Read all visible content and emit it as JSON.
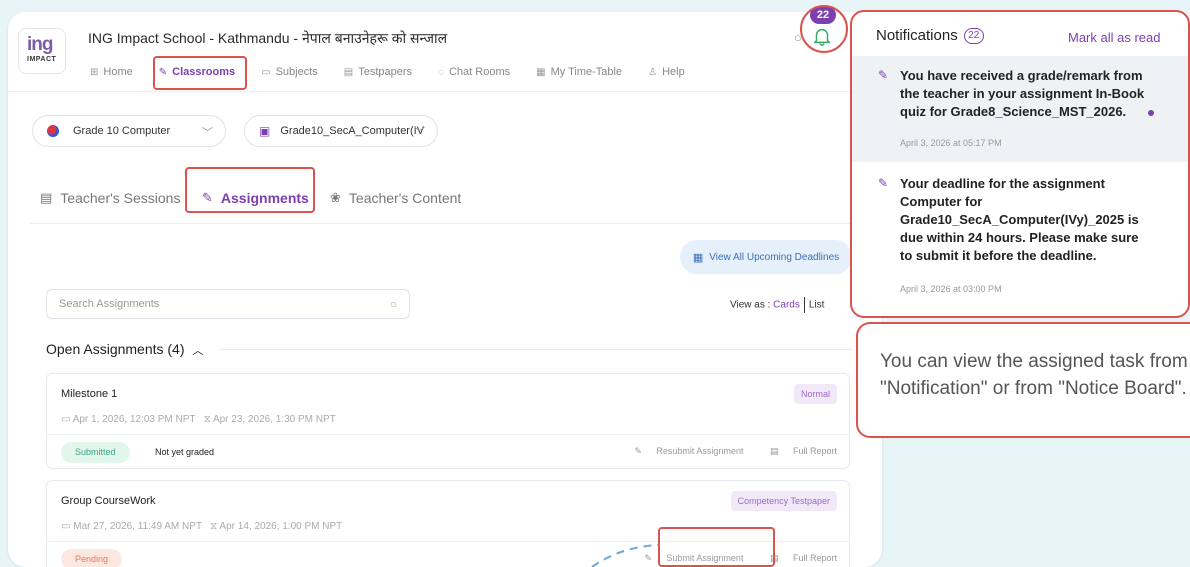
{
  "header": {
    "logo": {
      "word": "ing",
      "sub": "IMPACT"
    },
    "school_title": "ING Impact School - Kathmandu - नेपाल बनाउनेहरू को सन्जाल",
    "nav": [
      {
        "label": "Home",
        "icon": "grid-icon",
        "active": false
      },
      {
        "label": "Classrooms",
        "icon": "pen-icon",
        "active": true
      },
      {
        "label": "Subjects",
        "icon": "book-icon",
        "active": false
      },
      {
        "label": "Testpapers",
        "icon": "document-icon",
        "active": false
      },
      {
        "label": "Chat Rooms",
        "icon": "chat-icon",
        "active": false
      },
      {
        "label": "My Time-Table",
        "icon": "calendar-icon",
        "active": false
      },
      {
        "label": "Help",
        "icon": "person-icon",
        "active": false
      }
    ],
    "notification_badge": "22"
  },
  "filters": {
    "grade": "Grade 10 Computer",
    "section": "Grade10_SecA_Computer(IV"
  },
  "tabs": [
    {
      "label": "Teacher's Sessions",
      "active": false
    },
    {
      "label": "Assignments",
      "active": true
    },
    {
      "label": "Teacher's Content",
      "active": false
    }
  ],
  "content": {
    "deadlines_button": "View All Upcoming Deadlines",
    "search_placeholder": "Search Assignments",
    "view_as_label": "View as :",
    "view_cards": "Cards",
    "view_list": "List",
    "open_title": "Open Assignments (4)",
    "assignments": [
      {
        "title": "Milestone 1",
        "tag": "Normal",
        "start": "Apr 1, 2026, 12:03 PM NPT",
        "due": "Apr 23, 2026, 1:30 PM NPT",
        "status": "Submitted",
        "grade": "Not yet graded",
        "action": "Resubmit Assignment",
        "report": "Full Report"
      },
      {
        "title": "Group CourseWork",
        "tag": "Competency Testpaper",
        "start": "Mar 27, 2026, 11:49 AM NPT",
        "due": "Apr 14, 2026, 1:00 PM NPT",
        "status": "Pending",
        "grade": "",
        "action": "Submit Assignment",
        "report": "Full Report"
      }
    ]
  },
  "notifications": {
    "title": "Notifications",
    "count": "22",
    "mark_all": "Mark all as read",
    "items": [
      {
        "text": "You have received a grade/remark from the teacher in your assignment In-Book quiz for Grade8_Science_MST_2026.",
        "time": "April 3, 2026 at 05:17 PM",
        "unread": true
      },
      {
        "text": "Your deadline for the assignment Computer for Grade10_SecA_Computer(IVy)_2025 is due within 24 hours. Please make sure to submit it before the deadline.",
        "time": "April 3, 2026 at 03:00 PM",
        "unread": false
      }
    ]
  },
  "callout": {
    "text": "You can view the assigned task from \"Notification\" or from \"Notice Board\"."
  },
  "colors": {
    "accent": "#7b3fb0",
    "highlight": "#d9534f",
    "background": "#e8f5f8"
  }
}
